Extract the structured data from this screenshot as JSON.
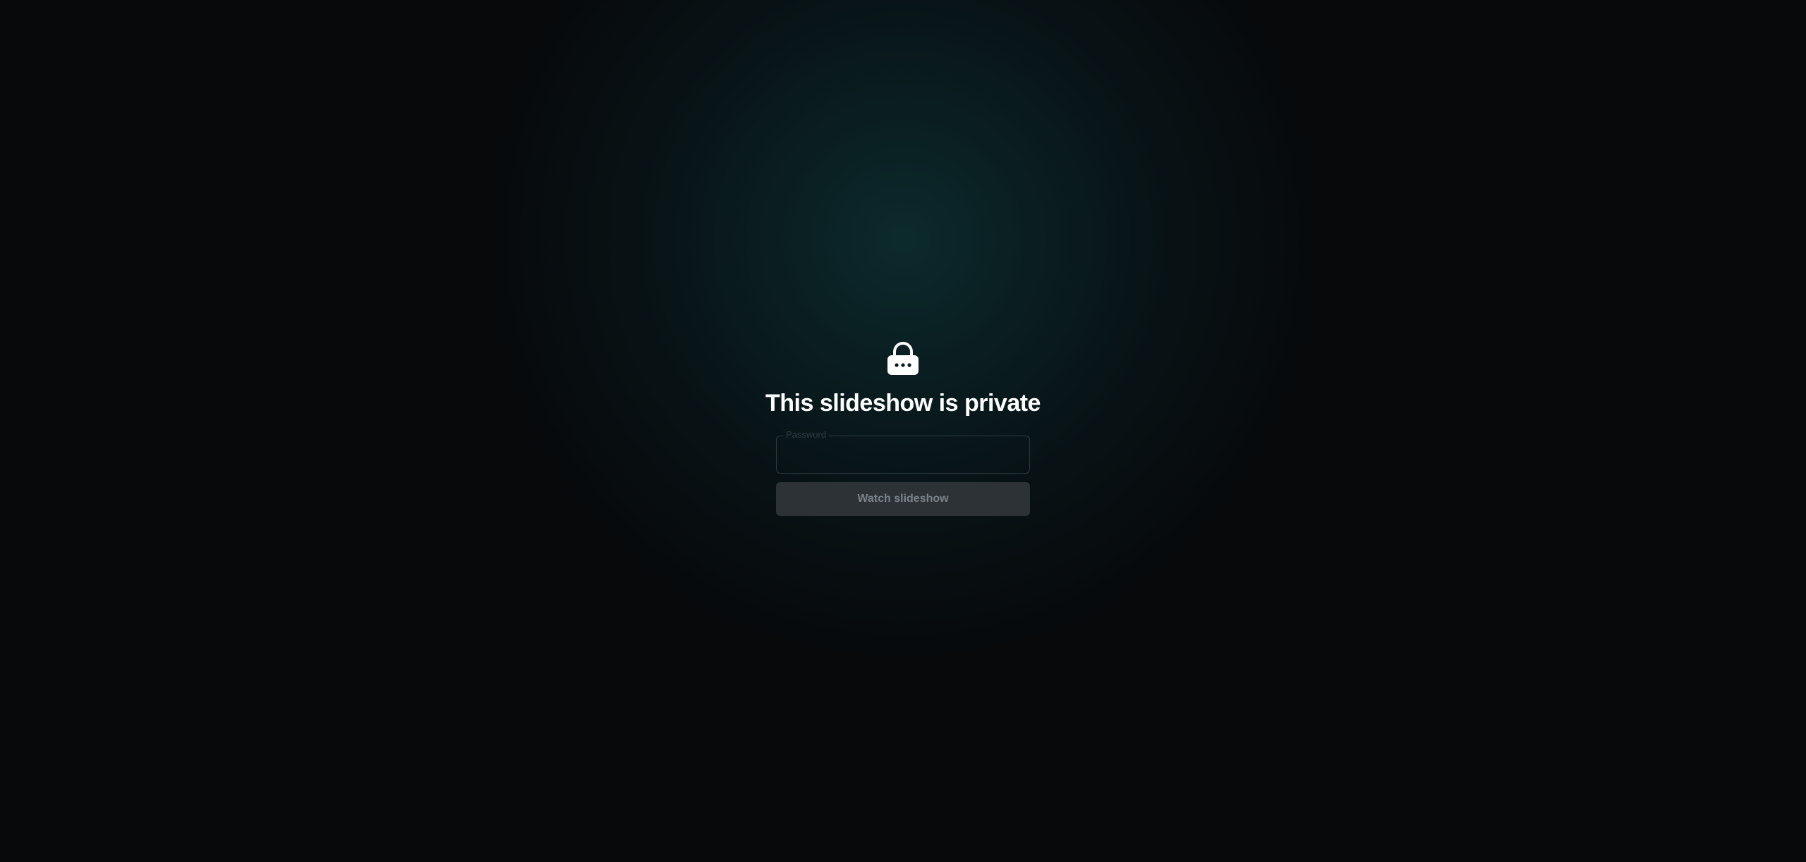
{
  "page": {
    "title": "This slideshow is private",
    "icon": "lock-icon"
  },
  "form": {
    "password_label": "Password",
    "password_value": "",
    "submit_label": "Watch slideshow",
    "submit_disabled": true
  },
  "colors": {
    "background": "#07090b",
    "glow": "#0c2a2c",
    "button_bg": "#2c3236",
    "button_text": "#7b858b",
    "title_text": "#ffffff"
  }
}
